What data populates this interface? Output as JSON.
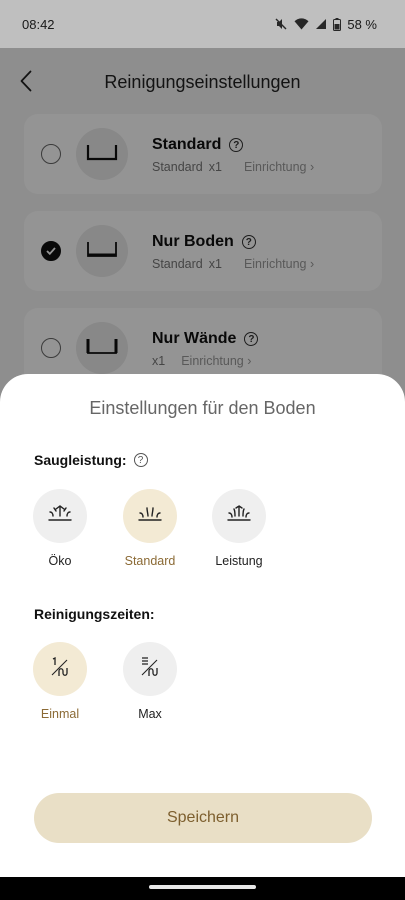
{
  "status_bar": {
    "time": "08:42",
    "battery": "58 %"
  },
  "header": {
    "title": "Reinigungseinstellungen",
    "back_icon": "chevron-left-icon"
  },
  "modes": [
    {
      "name": "Standard",
      "detail_mode": "Standard",
      "detail_count": "x1",
      "link": "Einrichtung",
      "selected": false
    },
    {
      "name": "Nur Boden",
      "detail_mode": "Standard",
      "detail_count": "x1",
      "link": "Einrichtung",
      "selected": true
    },
    {
      "name": "Nur Wände",
      "detail_mode": "",
      "detail_count": "x1",
      "link": "Einrichtung",
      "selected": false
    }
  ],
  "sheet": {
    "title": "Einstellungen für den Boden",
    "suction": {
      "label": "Saugleistung:",
      "options": [
        {
          "label": "Öko",
          "icon": "suction-eco-icon",
          "active": false
        },
        {
          "label": "Standard",
          "icon": "suction-standard-icon",
          "active": true
        },
        {
          "label": "Leistung",
          "icon": "suction-power-icon",
          "active": false
        }
      ]
    },
    "cycles": {
      "label": "Reinigungszeiten:",
      "options": [
        {
          "label": "Einmal",
          "icon": "once-icon",
          "active": true
        },
        {
          "label": "Max",
          "icon": "max-icon",
          "active": false
        }
      ]
    },
    "save_label": "Speichern"
  },
  "colors": {
    "accent": "#8b6a35",
    "accent_bg": "#f3ead4",
    "button_bg": "#e9dfc6"
  }
}
